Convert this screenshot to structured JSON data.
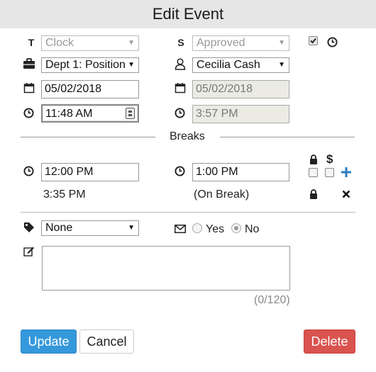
{
  "dialog": {
    "title": "Edit Event"
  },
  "row_type": {
    "type_label": "T",
    "type_value": "Clock",
    "status_label": "S",
    "status_value": "Approved"
  },
  "row_position": {
    "position_value": "Dept 1: Position",
    "employee_value": "Cecilia Cash"
  },
  "row_dates": {
    "start_date": "05/02/2018",
    "end_date": "05/02/2018"
  },
  "row_times": {
    "start_time": "11:48 AM",
    "end_time": "3:57 PM"
  },
  "breaks": {
    "section_label": "Breaks",
    "paid_symbol": "$",
    "break_start": "12:00 PM",
    "break_end": "1:00 PM",
    "break2_start": "3:35 PM",
    "break2_status": "(On Break)"
  },
  "extras": {
    "tag_value": "None",
    "notify_yes": "Yes",
    "notify_no": "No",
    "notify_selected": "No",
    "note_counter": "(0/120)"
  },
  "actions": {
    "update_label": "Update",
    "cancel_label": "Cancel",
    "delete_label": "Delete"
  },
  "colors": {
    "primary": "#3498db",
    "danger": "#d9534f",
    "add_icon": "#2a7bbf"
  }
}
